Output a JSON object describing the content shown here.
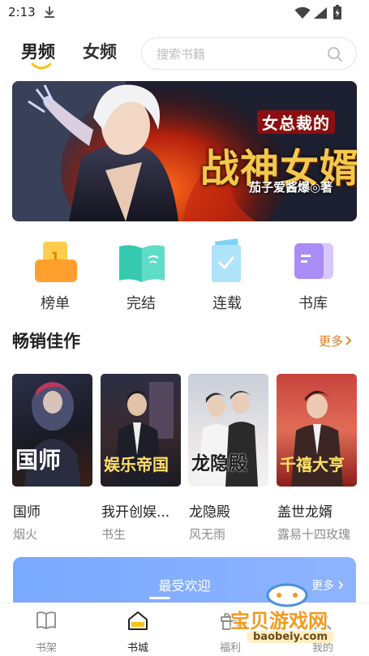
{
  "status_bar": {
    "time": "2:13",
    "icons": [
      "download-icon",
      "wifi-icon",
      "cellular-icon",
      "battery-icon"
    ]
  },
  "header": {
    "tabs": [
      {
        "label": "男频",
        "active": true
      },
      {
        "label": "女频",
        "active": false
      }
    ],
    "search": {
      "placeholder": "搜索书籍",
      "value": ""
    }
  },
  "banner": {
    "subtitle": "女总裁的",
    "title": "战神女婿",
    "author_line": "茄子爱酱爆◎著"
  },
  "quick_nav": [
    {
      "label": "榜单",
      "icon": "ranking-icon"
    },
    {
      "label": "完结",
      "icon": "finished-book-icon"
    },
    {
      "label": "连载",
      "icon": "serial-book-icon"
    },
    {
      "label": "书库",
      "icon": "library-icon"
    }
  ],
  "bestsellers": {
    "title": "畅销佳作",
    "more_label": "更多",
    "books": [
      {
        "title": "国师",
        "author": "烟火",
        "cover_text": "国师"
      },
      {
        "title": "我开创娱...",
        "author": "书生",
        "cover_text": "娱乐帝国"
      },
      {
        "title": "龙隐殿",
        "author": "风无雨",
        "cover_text": "龙隐殿"
      },
      {
        "title": "盖世龙婿",
        "author": "露易十四玫瑰",
        "cover_text": "千禧大亨"
      }
    ]
  },
  "favorites": {
    "title": "最受欢迎",
    "more_label": "更多"
  },
  "bottom_nav": [
    {
      "label": "书架",
      "icon": "bookshelf-icon",
      "active": false
    },
    {
      "label": "书城",
      "icon": "bookstore-icon",
      "active": true
    },
    {
      "label": "福利",
      "icon": "gift-icon",
      "active": false
    },
    {
      "label": "我的",
      "icon": "profile-icon",
      "active": false
    }
  ],
  "watermark": {
    "text": "宝贝游戏网",
    "url": "baobeiy.com"
  },
  "colors": {
    "accent_orange": "#e07a1f",
    "tab_underline": "#f5c518",
    "favorites_blue": "#79a9ff",
    "banner_title_gold": "#f2c94c"
  }
}
